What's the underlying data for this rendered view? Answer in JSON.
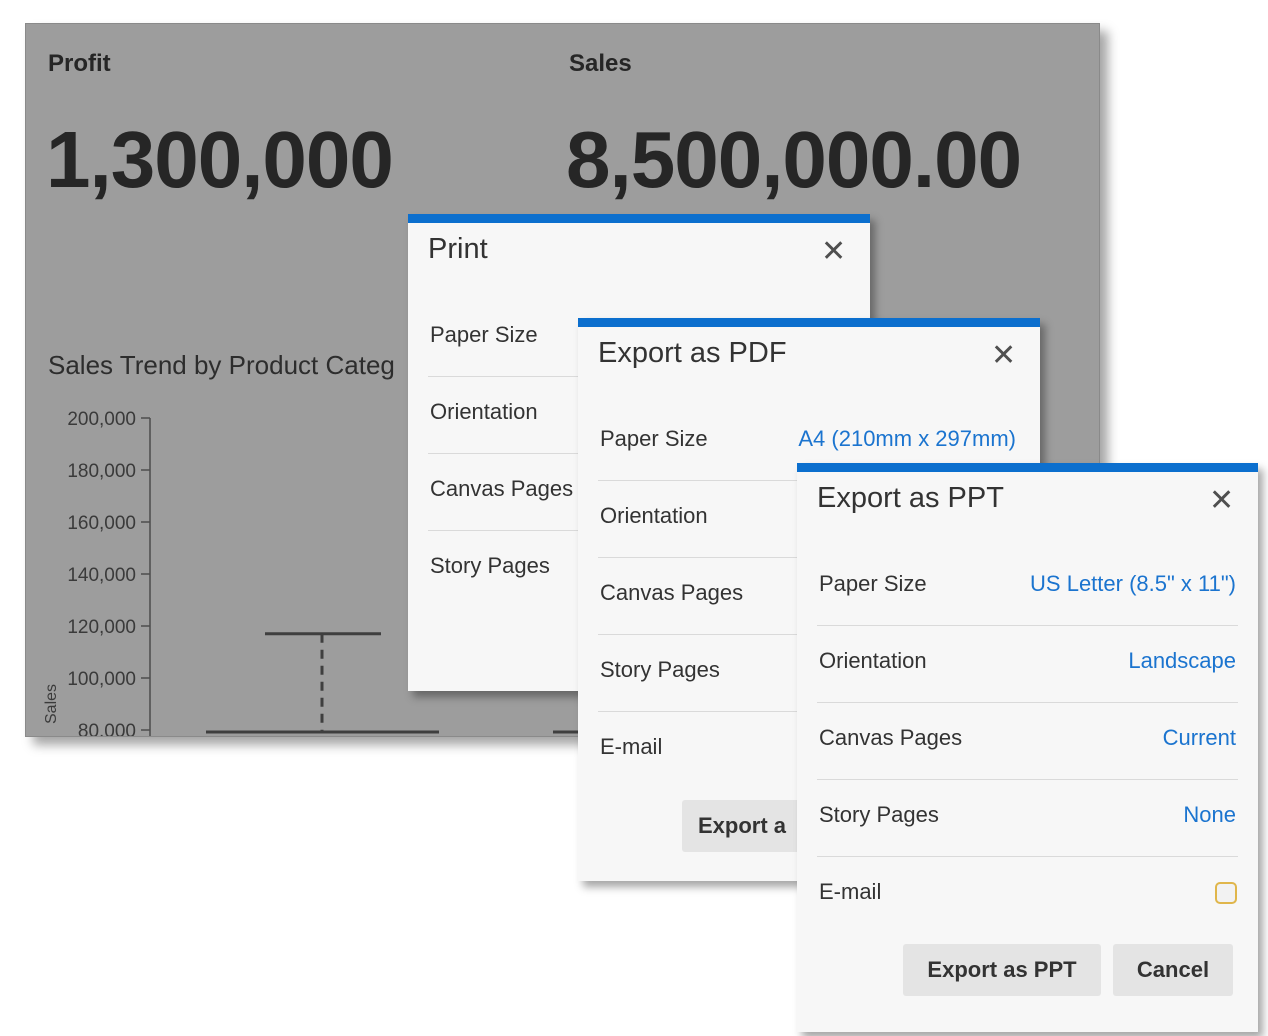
{
  "dashboard": {
    "profit": {
      "label": "Profit",
      "value": "1,300,000"
    },
    "sales": {
      "label": "Sales",
      "value": "8,500,000.00"
    },
    "chart_title": "Sales Trend by Product Categ"
  },
  "chart_data": {
    "type": "line",
    "title": "Sales Trend by Product Categ",
    "ylabel": "Sales",
    "yticks": [
      "200,000",
      "180,000",
      "160,000",
      "140,000",
      "120,000",
      "100,000",
      "80,000"
    ],
    "ylim": [
      80000,
      200000
    ],
    "markers": [
      {
        "kind": "reference-line",
        "value": 117000
      }
    ]
  },
  "print_dialog": {
    "title": "Print",
    "rows": [
      {
        "label": "Paper Size"
      },
      {
        "label": "Orientation"
      },
      {
        "label": "Canvas Pages"
      },
      {
        "label": "Story Pages"
      }
    ]
  },
  "pdf_dialog": {
    "title": "Export as PDF",
    "rows": [
      {
        "label": "Paper Size",
        "value": "A4 (210mm x 297mm)"
      },
      {
        "label": "Orientation"
      },
      {
        "label": "Canvas Pages"
      },
      {
        "label": "Story Pages"
      },
      {
        "label": "E-mail"
      }
    ],
    "export_button": "Export a"
  },
  "ppt_dialog": {
    "title": "Export as PPT",
    "rows": [
      {
        "label": "Paper Size",
        "value": "US Letter (8.5\" x 11\")"
      },
      {
        "label": "Orientation",
        "value": "Landscape"
      },
      {
        "label": "Canvas Pages",
        "value": "Current"
      },
      {
        "label": "Story Pages",
        "value": "None"
      },
      {
        "label": "E-mail"
      }
    ],
    "email_checked": false,
    "export_button": "Export as PPT",
    "cancel_button": "Cancel"
  },
  "colors": {
    "accent": "#0c6fce",
    "link": "#1b74cf",
    "dashboard_bg": "#9d9d9d",
    "checkbox_border": "#e0b64b"
  },
  "icons": {
    "close": "close-icon"
  }
}
